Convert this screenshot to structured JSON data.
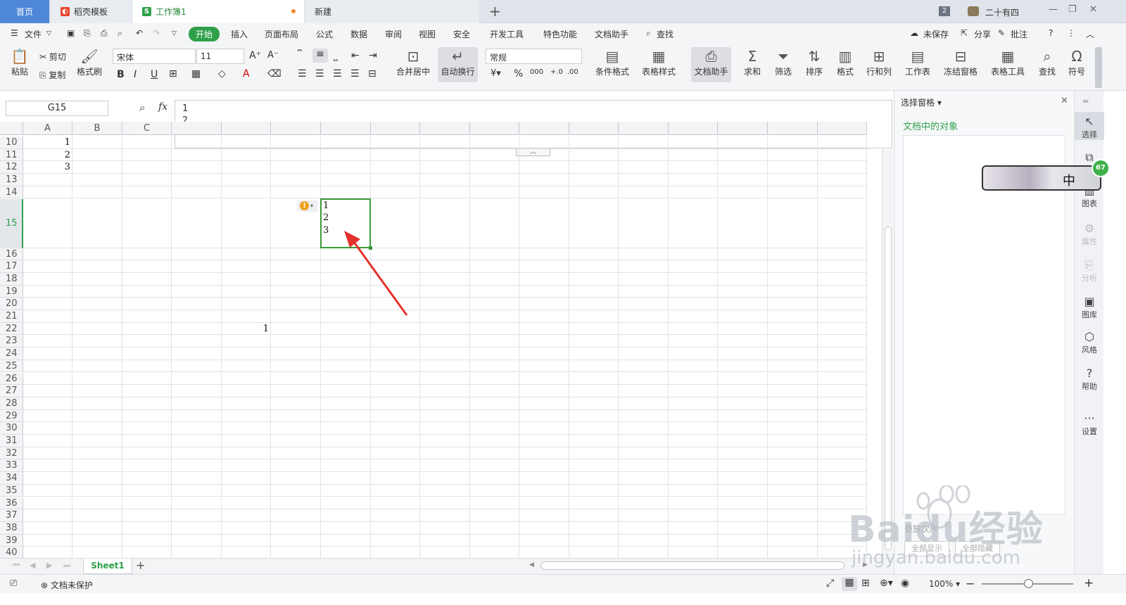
{
  "tabs": {
    "home": "首页",
    "template": "稻壳模板",
    "workbook": "工作簿1",
    "new": "新建",
    "window_count": "2",
    "user_name": "二十有四"
  },
  "menu": {
    "file": "文件",
    "start": "开始",
    "insert": "插入",
    "page_layout": "页面布局",
    "formula": "公式",
    "data": "数据",
    "review": "审阅",
    "view": "视图",
    "security": "安全",
    "dev_tools": "开发工具",
    "special": "特色功能",
    "doc_helper": "文档助手",
    "find": "查找",
    "unsaved": "未保存",
    "share": "分享",
    "comment": "批注"
  },
  "ribbon": {
    "paste": "粘贴",
    "cut": "剪切",
    "copy": "复制",
    "format_painter": "格式刷",
    "font_name": "宋体",
    "font_size": "11",
    "merge_center": "合并居中",
    "wrap_text": "自动换行",
    "number_format": "常规",
    "cond_format": "条件格式",
    "table_style": "表格样式",
    "doc_helper": "文档助手",
    "sum": "求和",
    "filter": "筛选",
    "sort": "排序",
    "format": "格式",
    "row_col": "行和列",
    "worksheet": "工作表",
    "freeze": "冻结窗格",
    "table_tools": "表格工具",
    "find": "查找",
    "symbol": "符号"
  },
  "formula_bar": {
    "name_box": "G15",
    "fx": "fx",
    "content": "1\n2\n3"
  },
  "grid": {
    "columns": [
      "A",
      "B",
      "C"
    ],
    "rows": [
      "10",
      "11",
      "12",
      "13",
      "14",
      "15",
      "16",
      "17",
      "18",
      "19",
      "20",
      "21",
      "22",
      "23",
      "24",
      "25",
      "26",
      "27",
      "28",
      "29",
      "30",
      "31",
      "32",
      "33",
      "34",
      "35",
      "36",
      "37",
      "38",
      "39",
      "40"
    ],
    "a10": "1",
    "a11": "2",
    "a12": "3",
    "g15": "1\n2\n3",
    "e22": "1"
  },
  "selection_pane": {
    "title": "选择窗格",
    "objects_label": "文档中的对象",
    "sort_label": "叠放次序",
    "show_all": "全部显示",
    "hide_all": "全部隐藏"
  },
  "sidebar": {
    "select": "选择",
    "chart": "图表",
    "property": "属性",
    "analyze": "分析",
    "gallery": "图库",
    "style": "风格",
    "help": "帮助",
    "settings": "设置"
  },
  "ime": {
    "label": "中",
    "badge": "67"
  },
  "sheets": {
    "active": "Sheet1"
  },
  "status": {
    "protect": "文档未保护",
    "zoom": "100%"
  },
  "watermark": {
    "main": "Baidu经验",
    "url": "jingyan.baidu.com"
  },
  "colors": {
    "accent_green": "#2fa04a",
    "selection": "#3a9a3a",
    "arrow": "#e5322d"
  }
}
